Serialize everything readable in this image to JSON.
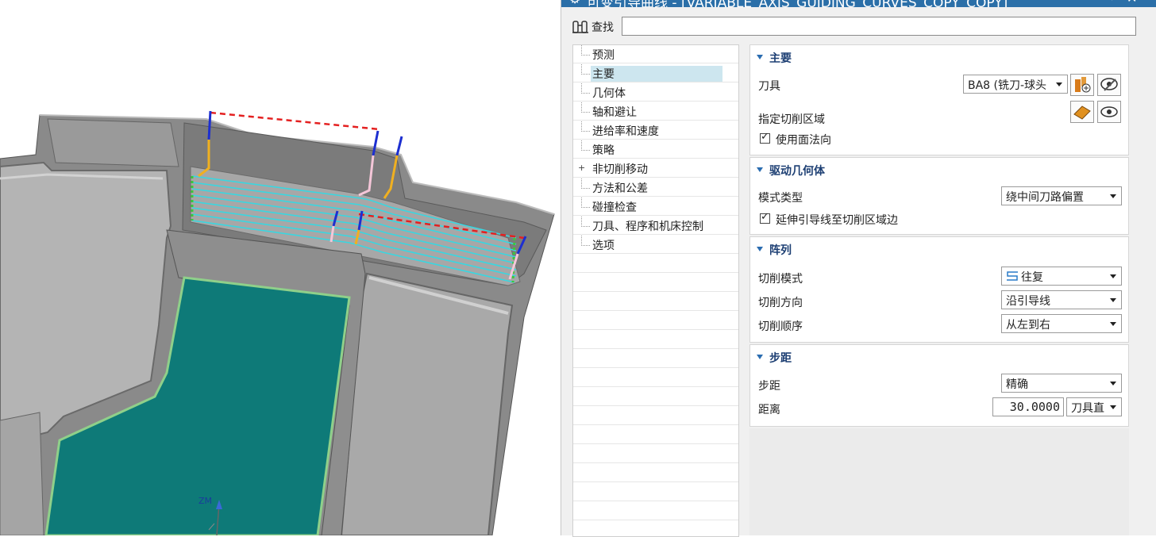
{
  "dialog": {
    "title": "可变引导曲线 - [VARIABLE_AXIS_GUIDING_CURVES_COPY_COPY]",
    "find_label": "查找",
    "find_placeholder": ""
  },
  "tree": {
    "items": [
      {
        "label": "预测"
      },
      {
        "label": "主要",
        "selected": true
      },
      {
        "label": "几何体"
      },
      {
        "label": "轴和避让"
      },
      {
        "label": "进给率和速度"
      },
      {
        "label": "策略"
      },
      {
        "label": "非切削移动",
        "expandable": true
      },
      {
        "label": "方法和公差"
      },
      {
        "label": "碰撞检查"
      },
      {
        "label": "刀具、程序和机床控制"
      },
      {
        "label": "选项"
      }
    ]
  },
  "main": {
    "heading": "主要",
    "tool_label": "刀具",
    "tool_value": "BA8 (铣刀-球头",
    "cut_area_label": "指定切削区域",
    "use_face_normal_label": "使用面法向",
    "use_face_normal_checked": true
  },
  "drive": {
    "heading": "驱动几何体",
    "pattern_type_label": "模式类型",
    "pattern_type_value": "绕中间刀路偏置",
    "extend_label": "延伸引导线至切削区域边",
    "extend_checked": true
  },
  "array": {
    "heading": "阵列",
    "cut_mode_label": "切削模式",
    "cut_mode_value": "往复",
    "cut_dir_label": "切削方向",
    "cut_dir_value": "沿引导线",
    "cut_order_label": "切削顺序",
    "cut_order_value": "从左到右"
  },
  "stepover": {
    "heading": "步距",
    "step_label": "步距",
    "step_value": "精确",
    "distance_label": "距离",
    "distance_value": "30.0000",
    "distance_unit": "刀具直"
  },
  "viewport": {
    "triad_label": "ZM"
  },
  "icons": {
    "gear": "gear-icon",
    "pin": "pin-icon",
    "close": "close-icon",
    "find": "binoculars-icon",
    "new_tool": "new-tool-icon",
    "edit_tool": "edit-tool-icon",
    "select_face": "select-face-icon",
    "display": "eye-icon",
    "zigzag": "zigzag-pattern-icon"
  },
  "colors": {
    "title_bar": "#2b6fa8",
    "section_heading": "#1d3f73",
    "tree_selected": "#cde6ef",
    "floor_surface": "#0e7a78",
    "toolpath": "#3ad6e0",
    "guide_curve": "#e42020"
  }
}
